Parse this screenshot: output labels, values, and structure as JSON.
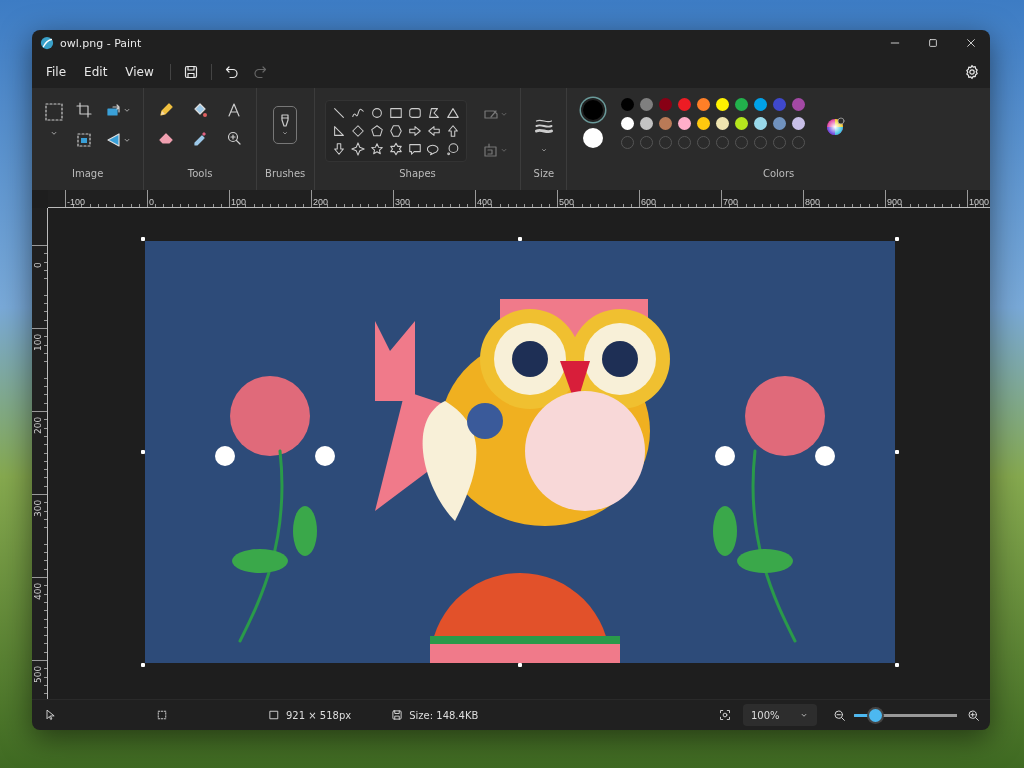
{
  "window": {
    "title": "owl.png - Paint"
  },
  "menu": [
    "File",
    "Edit",
    "View"
  ],
  "quick_actions": [
    {
      "kind": "save",
      "disabled": false
    },
    {
      "kind": "undo",
      "disabled": false
    },
    {
      "kind": "redo",
      "disabled": true
    }
  ],
  "ribbon": {
    "groups": [
      {
        "kind": "image",
        "label": "Image"
      },
      {
        "kind": "tools",
        "label": "Tools"
      },
      {
        "kind": "brushes",
        "label": "Brushes"
      },
      {
        "kind": "shapes",
        "label": "Shapes"
      },
      {
        "kind": "size",
        "label": "Size"
      },
      {
        "kind": "colors",
        "label": "Colors"
      }
    ]
  },
  "colors": {
    "primary": {
      "color": "#000000"
    },
    "secondary": {
      "color": "#ffffff"
    },
    "palette": [
      {
        "color": "#000000"
      },
      {
        "color": "#7f7f7f"
      },
      {
        "color": "#880015"
      },
      {
        "color": "#ed1c24"
      },
      {
        "color": "#ff7f27"
      },
      {
        "color": "#fff200"
      },
      {
        "color": "#22b14c"
      },
      {
        "color": "#00a2e8"
      },
      {
        "color": "#3f48cc"
      },
      {
        "color": "#a349a4"
      },
      {
        "color": "#ffffff"
      },
      {
        "color": "#c3c3c3"
      },
      {
        "color": "#b97a57"
      },
      {
        "color": "#ffaec9"
      },
      {
        "color": "#ffc90e"
      },
      {
        "color": "#efe4b0"
      },
      {
        "color": "#b5e61d"
      },
      {
        "color": "#99d9ea"
      },
      {
        "color": "#7092be"
      },
      {
        "color": "#c8bfe7"
      }
    ],
    "custom_slots": [
      {
        "filled": false
      },
      {
        "filled": false
      },
      {
        "filled": false
      },
      {
        "filled": false
      },
      {
        "filled": false
      },
      {
        "filled": false
      },
      {
        "filled": false
      },
      {
        "filled": false
      },
      {
        "filled": false
      },
      {
        "filled": false
      }
    ]
  },
  "rulers": {
    "horizontal": [
      "-100",
      "0",
      "100",
      "200",
      "300",
      "400",
      "500",
      "600",
      "700",
      "800",
      "900",
      "1000"
    ],
    "vertical": [
      "0",
      "100",
      "200",
      "300",
      "400",
      "500"
    ]
  },
  "status_bar": {
    "dimensions": "921 × 518px",
    "size": "Size: 148.4KB",
    "zoom": {
      "value": "100%",
      "level": 0.17
    }
  }
}
